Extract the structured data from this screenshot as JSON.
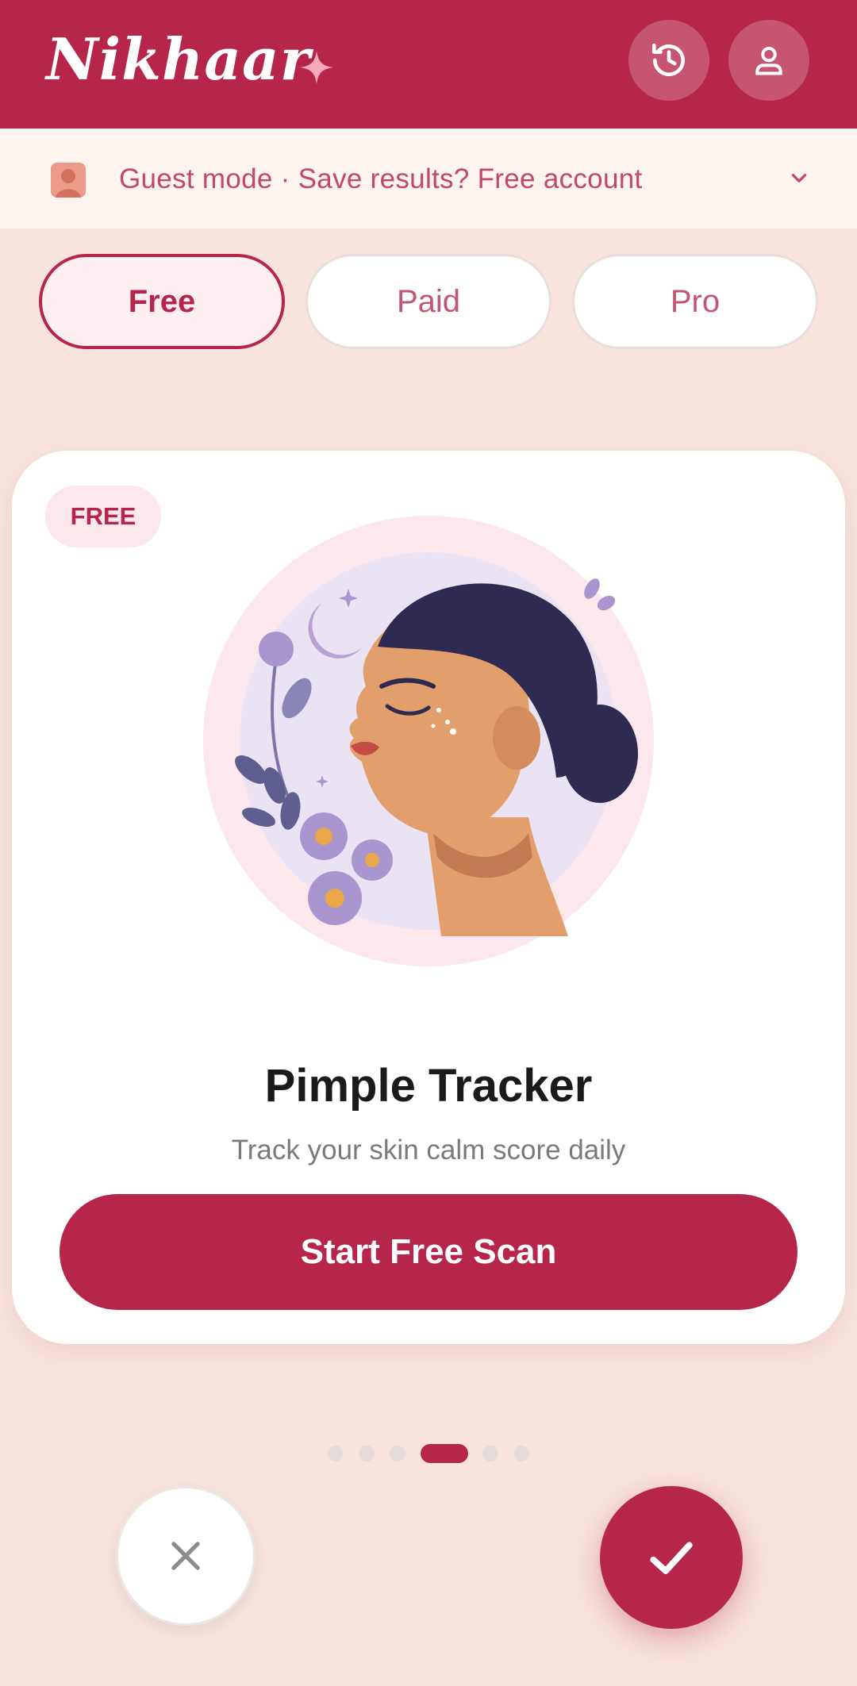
{
  "app": {
    "brand": "Nikhaar",
    "icons": {
      "sparkle": "sparkle-icon",
      "history": "history-icon",
      "profile": "profile-icon"
    }
  },
  "guest_banner": {
    "text": "Guest mode · Save results? Free account",
    "icon": "guest-avatar-icon",
    "chevron": "chevron-down-icon"
  },
  "tiers": {
    "selected": "Free",
    "items": [
      {
        "label": "Free"
      },
      {
        "label": "Paid"
      },
      {
        "label": "Pro"
      }
    ]
  },
  "card": {
    "badge": "FREE",
    "title": "Pimple Tracker",
    "subtitle": "Track your skin calm score daily",
    "cta": "Start Free Scan",
    "illustration": "woman-profile-with-flowers-illustration"
  },
  "pager": {
    "count": 6,
    "active_index": 3
  },
  "actions": {
    "dismiss_icon": "close-icon",
    "confirm_icon": "check-icon"
  },
  "colors": {
    "brand": "#b5264a",
    "background": "#f8e4dc",
    "banner_bg": "#fdf4f0",
    "badge_bg": "#fbe7ec"
  }
}
